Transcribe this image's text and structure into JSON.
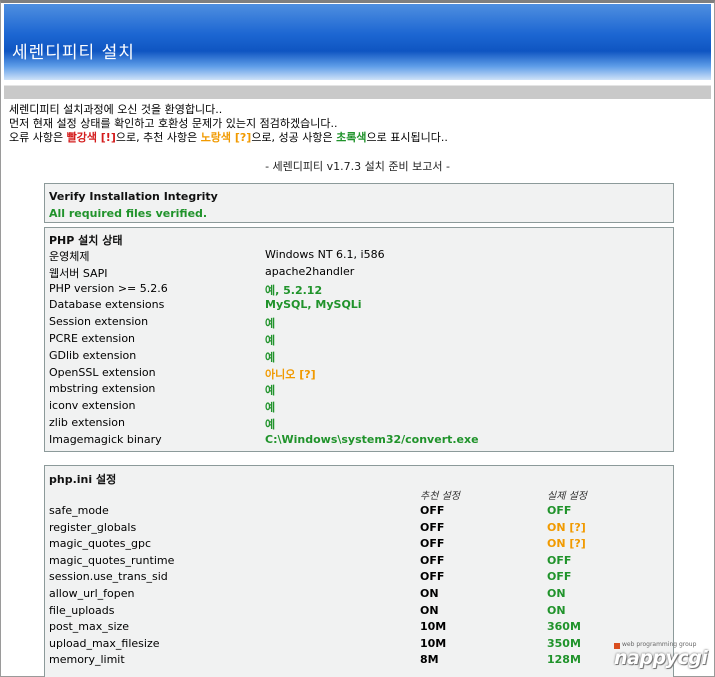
{
  "banner": {
    "title": "세렌디피티 설치"
  },
  "intro": {
    "line1": "세렌디피티 설치과정에 오신 것을 환영합니다..",
    "line2": "먼저 현재 설정 상태를 확인하고 호환성 문제가 있는지 점검하겠습니다..",
    "line3_a": "오류 사항은 ",
    "line3_red": "빨강색 [!]",
    "line3_b": "으로, 추천 사항은 ",
    "line3_yellow": "노랑색 [?]",
    "line3_c": "으로, 성공 사항은 ",
    "line3_green": "초록색",
    "line3_d": "으로 표시됩니다.."
  },
  "report_title": "- 세렌디피티 v1.7.3 설치 준비 보고서 -",
  "verify": {
    "title": "Verify Installation Integrity",
    "status": "All required files verified."
  },
  "php_status": {
    "title": "PHP 설치 상태",
    "rows": [
      {
        "label": "운영체제",
        "value": "Windows NT 6.1, i586",
        "state": "plain"
      },
      {
        "label": "웹서버 SAPI",
        "value": "apache2handler",
        "state": "plain"
      },
      {
        "label": "PHP version >= 5.2.6",
        "value": "예, 5.2.12",
        "state": "green"
      },
      {
        "label": "Database extensions",
        "value": "MySQL, MySQLi",
        "state": "green"
      },
      {
        "label": "Session extension",
        "value": "예",
        "state": "green"
      },
      {
        "label": "PCRE extension",
        "value": "예",
        "state": "green"
      },
      {
        "label": "GDlib extension",
        "value": "예",
        "state": "green"
      },
      {
        "label": "OpenSSL extension",
        "value": "아니오 [?]",
        "state": "yellow"
      },
      {
        "label": "mbstring extension",
        "value": "예",
        "state": "green"
      },
      {
        "label": "iconv extension",
        "value": "예",
        "state": "green"
      },
      {
        "label": "zlib extension",
        "value": "예",
        "state": "green"
      },
      {
        "label": "Imagemagick binary",
        "value": "C:\\Windows\\system32/convert.exe",
        "state": "green"
      }
    ]
  },
  "php_ini": {
    "title": "php.ini 설정",
    "col_recommended": "추천 설정",
    "col_actual": "실제 설정",
    "rows": [
      {
        "label": "safe_mode",
        "recommended": "OFF",
        "actual": "OFF",
        "state": "green"
      },
      {
        "label": "register_globals",
        "recommended": "OFF",
        "actual": "ON [?]",
        "state": "yellow"
      },
      {
        "label": "magic_quotes_gpc",
        "recommended": "OFF",
        "actual": "ON [?]",
        "state": "yellow"
      },
      {
        "label": "magic_quotes_runtime",
        "recommended": "OFF",
        "actual": "OFF",
        "state": "green"
      },
      {
        "label": "session.use_trans_sid",
        "recommended": "OFF",
        "actual": "OFF",
        "state": "green"
      },
      {
        "label": "allow_url_fopen",
        "recommended": "ON",
        "actual": "ON",
        "state": "green"
      },
      {
        "label": "file_uploads",
        "recommended": "ON",
        "actual": "ON",
        "state": "green"
      },
      {
        "label": "post_max_size",
        "recommended": "10M",
        "actual": "360M",
        "state": "green"
      },
      {
        "label": "upload_max_filesize",
        "recommended": "10M",
        "actual": "350M",
        "state": "green"
      },
      {
        "label": "memory_limit",
        "recommended": "8M",
        "actual": "128M",
        "state": "green"
      }
    ]
  },
  "watermark": {
    "small": "web programming group",
    "text": "nappycgi"
  },
  "colors": {
    "error": "#d41c1c",
    "recommend": "#f19a00",
    "success": "#20932b"
  }
}
